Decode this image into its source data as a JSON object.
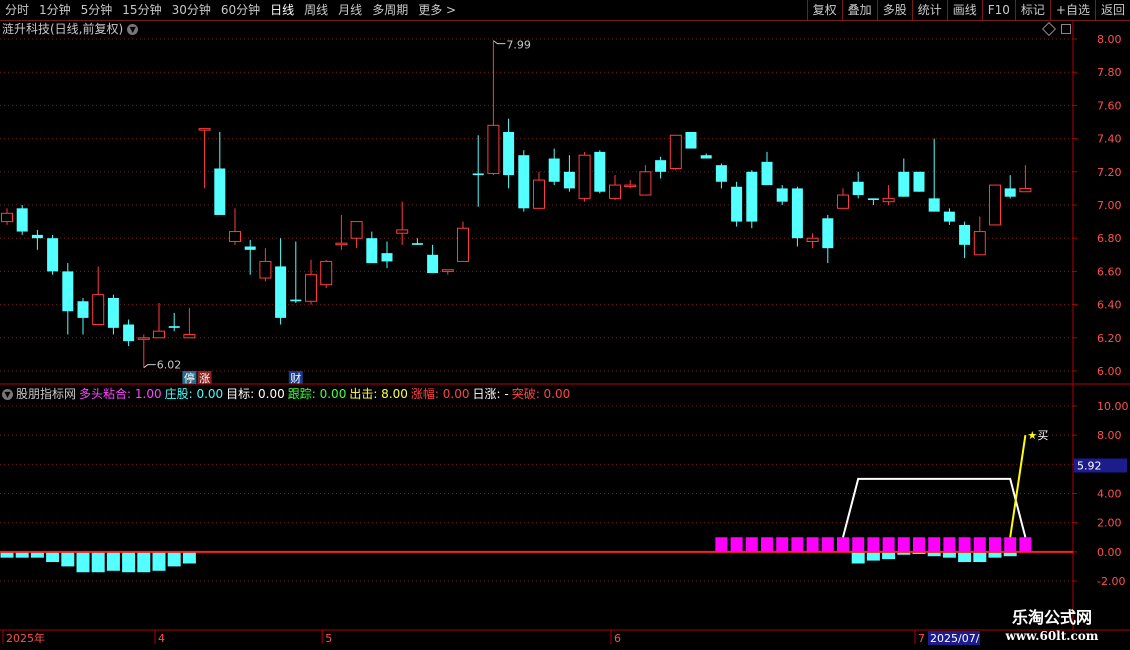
{
  "toolbar": {
    "periods": [
      "分时",
      "1分钟",
      "5分钟",
      "15分钟",
      "30分钟",
      "60分钟",
      "日线",
      "周线",
      "月线",
      "多周期",
      "更多 >"
    ],
    "active": "日线",
    "tools": [
      "复权",
      "叠加",
      "多股",
      "统计",
      "画线",
      "F10",
      "标记",
      "+自选",
      "返回"
    ]
  },
  "main_title": "涟升科技(日线,前复权)",
  "indicator": {
    "name": "股朋指标网",
    "fields": [
      {
        "label": "多头粘合:",
        "value": "1.00",
        "color": "#ff44ff"
      },
      {
        "label": "庄股:",
        "value": "0.00",
        "color": "#44ffff"
      },
      {
        "label": "目标:",
        "value": "0.00",
        "color": "#ffffff"
      },
      {
        "label": "跟踪:",
        "value": "0.00",
        "color": "#44ff44"
      },
      {
        "label": "出击:",
        "value": "8.00",
        "color": "#ffff44"
      },
      {
        "label": "涨幅:",
        "value": "0.00",
        "color": "#ff4444"
      },
      {
        "label": "日涨:",
        "value": "-",
        "color": "#ffffff"
      },
      {
        "label": "突破:",
        "value": "0.00",
        "color": "#ff4444"
      }
    ]
  },
  "chart_data": [
    {
      "type": "candlestick",
      "price_axis": [
        "8.00",
        "7.80",
        "7.60",
        "7.40",
        "7.20",
        "7.00",
        "6.80",
        "6.60",
        "6.40",
        "6.20",
        "6.00"
      ],
      "ylim": [
        5.95,
        8.05
      ],
      "high_label": "7.99",
      "low_label": "6.02",
      "markers": [
        {
          "index": 12,
          "text": "停",
          "bg": "#2a6a8a"
        },
        {
          "index": 13,
          "text": "涨",
          "bg": "#8a2020"
        },
        {
          "index": 19,
          "text": "财",
          "bg": "#1a3a8a"
        }
      ],
      "candles": [
        [
          6.9,
          6.95,
          6.88,
          6.98
        ],
        [
          6.98,
          6.84,
          6.82,
          7.0
        ],
        [
          6.82,
          6.8,
          6.73,
          6.85
        ],
        [
          6.8,
          6.6,
          6.58,
          6.82
        ],
        [
          6.6,
          6.36,
          6.22,
          6.65
        ],
        [
          6.42,
          6.32,
          6.22,
          6.44
        ],
        [
          6.28,
          6.46,
          6.28,
          6.63
        ],
        [
          6.44,
          6.26,
          6.22,
          6.46
        ],
        [
          6.28,
          6.18,
          6.15,
          6.31
        ],
        [
          6.2,
          6.2,
          6.02,
          6.22
        ],
        [
          6.2,
          6.24,
          6.2,
          6.41
        ],
        [
          6.27,
          6.26,
          6.24,
          6.35
        ],
        [
          6.2,
          6.22,
          6.2,
          6.38
        ],
        [
          7.46,
          7.46,
          7.1,
          7.46
        ],
        [
          7.22,
          6.94,
          6.94,
          7.44
        ],
        [
          6.78,
          6.84,
          6.76,
          6.98
        ],
        [
          6.75,
          6.73,
          6.58,
          6.79
        ],
        [
          6.56,
          6.66,
          6.54,
          6.74
        ],
        [
          6.63,
          6.32,
          6.28,
          6.8
        ],
        [
          6.43,
          6.42,
          6.41,
          6.78
        ],
        [
          6.42,
          6.58,
          6.4,
          6.67
        ],
        [
          6.52,
          6.66,
          6.5,
          6.67
        ],
        [
          6.77,
          6.77,
          6.73,
          6.94
        ],
        [
          6.8,
          6.9,
          6.74,
          6.9
        ],
        [
          6.8,
          6.65,
          6.65,
          6.84
        ],
        [
          6.71,
          6.66,
          6.62,
          6.78
        ],
        [
          6.83,
          6.85,
          6.76,
          7.02
        ],
        [
          6.77,
          6.76,
          6.76,
          6.8
        ],
        [
          6.7,
          6.59,
          6.59,
          6.76
        ],
        [
          6.6,
          6.61,
          6.58,
          6.6
        ],
        [
          6.66,
          6.86,
          6.66,
          6.9
        ],
        [
          7.19,
          7.18,
          6.99,
          7.42
        ],
        [
          7.19,
          7.48,
          7.18,
          7.99
        ],
        [
          7.44,
          7.18,
          7.1,
          7.52
        ],
        [
          7.3,
          6.98,
          6.96,
          7.33
        ],
        [
          6.98,
          7.15,
          6.98,
          7.2
        ],
        [
          7.28,
          7.14,
          7.12,
          7.34
        ],
        [
          7.2,
          7.1,
          7.08,
          7.3
        ],
        [
          7.04,
          7.3,
          7.02,
          7.32
        ],
        [
          7.32,
          7.08,
          7.07,
          7.33
        ],
        [
          7.04,
          7.12,
          7.03,
          7.18
        ],
        [
          7.12,
          7.12,
          7.1,
          7.15
        ],
        [
          7.06,
          7.2,
          7.06,
          7.24
        ],
        [
          7.27,
          7.2,
          7.16,
          7.29
        ],
        [
          7.22,
          7.42,
          7.21,
          7.42
        ],
        [
          7.44,
          7.34,
          7.34,
          7.44
        ],
        [
          7.3,
          7.28,
          7.28,
          7.31
        ],
        [
          7.24,
          7.14,
          7.1,
          7.25
        ],
        [
          7.11,
          6.9,
          6.87,
          7.14
        ],
        [
          7.2,
          6.9,
          6.86,
          7.21
        ],
        [
          7.26,
          7.12,
          7.12,
          7.32
        ],
        [
          7.1,
          7.02,
          7.0,
          7.12
        ],
        [
          7.1,
          6.8,
          6.75,
          7.11
        ],
        [
          6.78,
          6.8,
          6.74,
          6.83
        ],
        [
          6.92,
          6.74,
          6.65,
          6.94
        ],
        [
          6.98,
          7.06,
          6.98,
          7.1
        ],
        [
          7.14,
          7.06,
          7.04,
          7.2
        ],
        [
          7.04,
          7.03,
          7.0,
          7.04
        ],
        [
          7.02,
          7.04,
          7.0,
          7.12
        ],
        [
          7.2,
          7.05,
          7.05,
          7.28
        ],
        [
          7.2,
          7.08,
          7.08,
          7.2
        ],
        [
          7.04,
          6.96,
          6.96,
          7.4
        ],
        [
          6.96,
          6.9,
          6.88,
          6.98
        ],
        [
          6.88,
          6.76,
          6.68,
          6.9
        ],
        [
          6.7,
          6.84,
          6.7,
          6.93
        ],
        [
          6.88,
          7.12,
          6.88,
          7.12
        ],
        [
          7.1,
          7.05,
          7.04,
          7.18
        ],
        [
          7.08,
          7.1,
          7.08,
          7.24
        ]
      ]
    },
    {
      "type": "bar",
      "indicator_axis": [
        "10.00",
        "8.00",
        "6.00",
        "4.00",
        "2.00",
        "0.00",
        "-2.00"
      ],
      "ylim": [
        -3,
        11
      ],
      "current_value_label": "5.92",
      "buy_label": "买",
      "cyan_bars": [
        [
          0,
          -0.4
        ],
        [
          1,
          -0.4
        ],
        [
          2,
          -0.4
        ],
        [
          3,
          -0.7
        ],
        [
          4,
          -1.0
        ],
        [
          5,
          -1.4
        ],
        [
          6,
          -1.4
        ],
        [
          7,
          -1.3
        ],
        [
          8,
          -1.4
        ],
        [
          9,
          -1.4
        ],
        [
          10,
          -1.3
        ],
        [
          11,
          -1.0
        ],
        [
          12,
          -0.8
        ],
        [
          56,
          -0.8
        ],
        [
          57,
          -0.6
        ],
        [
          58,
          -0.5
        ],
        [
          59,
          -0.2
        ],
        [
          60,
          -0.15
        ],
        [
          61,
          -0.3
        ],
        [
          62,
          -0.4
        ],
        [
          63,
          -0.7
        ],
        [
          64,
          -0.7
        ],
        [
          65,
          -0.4
        ],
        [
          66,
          -0.3
        ]
      ],
      "magenta_bars": [
        [
          47,
          1.0
        ],
        [
          48,
          1.0
        ],
        [
          49,
          1.0
        ],
        [
          50,
          1.0
        ],
        [
          51,
          1.0
        ],
        [
          52,
          1.0
        ],
        [
          53,
          1.0
        ],
        [
          54,
          1.0
        ],
        [
          55,
          1.0
        ],
        [
          56,
          1.0
        ],
        [
          57,
          1.0
        ],
        [
          58,
          1.0
        ],
        [
          59,
          1.0
        ],
        [
          60,
          1.0
        ],
        [
          61,
          1.0
        ],
        [
          62,
          1.0
        ],
        [
          63,
          1.0
        ],
        [
          64,
          1.0
        ],
        [
          65,
          1.0
        ],
        [
          66,
          1.0
        ],
        [
          67,
          1.0
        ]
      ],
      "white_line": [
        [
          55,
          1.0
        ],
        [
          56,
          5.0
        ],
        [
          66,
          5.0
        ],
        [
          67,
          1.0
        ]
      ],
      "yellow_line": [
        [
          66,
          1.0
        ],
        [
          67,
          8.0
        ]
      ]
    }
  ],
  "x_axis": [
    {
      "index": 0,
      "text": "2025年"
    },
    {
      "index": 10,
      "text": "4"
    },
    {
      "index": 21,
      "text": "5"
    },
    {
      "index": 40,
      "text": "6"
    },
    {
      "index": 60,
      "text": "7"
    }
  ],
  "date_label": "2025/07/",
  "colors": {
    "up": "#ff3c3c",
    "down": "#54ffff",
    "grid": "#7a1a1a",
    "axis": "#b40000",
    "magenta": "#ff00ff",
    "yellow": "#ffff00"
  },
  "watermark": {
    "line1": "乐淘公式网",
    "line2": "www.60lt.com"
  }
}
